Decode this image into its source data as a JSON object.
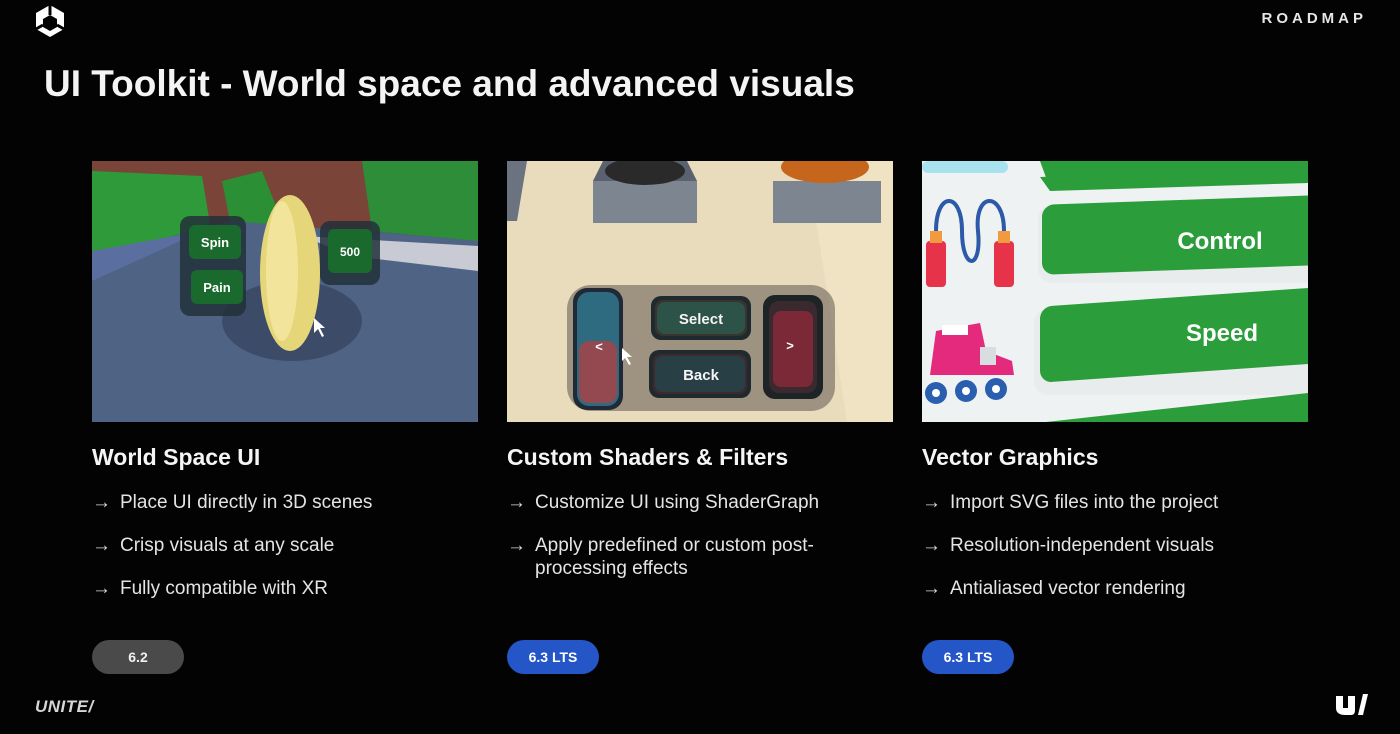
{
  "header": {
    "logo_icon": "unity-cube-icon",
    "section_label": "ROADMAP",
    "title": "UI Toolkit - World space and advanced visuals"
  },
  "cards": [
    {
      "title": "World Space UI",
      "image": {
        "buttons": [
          "Spin",
          "Pain",
          "500"
        ]
      },
      "bullets": [
        "Place UI directly in 3D scenes",
        "Crisp visuals at any scale",
        "Fully compatible with XR"
      ],
      "badge": "6.2",
      "badge_color": "#4a4a4a"
    },
    {
      "title": "Custom Shaders & Filters",
      "image": {
        "buttons": [
          "Select",
          "Back",
          "<",
          ">"
        ]
      },
      "bullets": [
        "Customize UI using ShaderGraph",
        "Apply predefined or custom post-processing effects"
      ],
      "badge": "6.3 LTS",
      "badge_color": "#2456c8"
    },
    {
      "title": "Vector Graphics",
      "image": {
        "buttons": [
          "Control",
          "Speed"
        ]
      },
      "bullets": [
        "Import SVG files into the project",
        "Resolution-independent visuals",
        "Antialiased vector rendering"
      ],
      "badge": "6.3 LTS",
      "badge_color": "#2456c8"
    }
  ],
  "footer": {
    "event_label": "UNITE/",
    "brand_icon": "unite-u-logo-icon"
  },
  "arrow_glyph": "→"
}
